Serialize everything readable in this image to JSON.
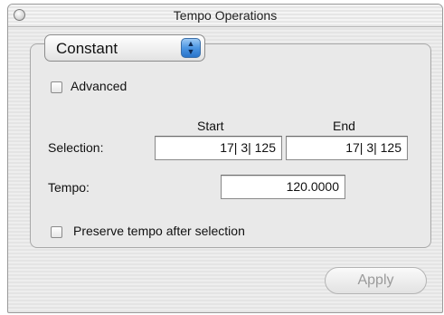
{
  "window": {
    "title": "Tempo Operations"
  },
  "mode_popup": {
    "selected": "Constant",
    "arrows_glyph": "▲\n▼"
  },
  "advanced": {
    "label": "Advanced",
    "checked": false
  },
  "selection": {
    "start_header": "Start",
    "end_header": "End",
    "label": "Selection:",
    "start_value": "17| 3| 125",
    "end_value": "17| 3| 125"
  },
  "tempo": {
    "label": "Tempo:",
    "value": "120.0000"
  },
  "preserve": {
    "label": "Preserve tempo after selection",
    "checked": false
  },
  "apply": {
    "label": "Apply",
    "enabled": false
  },
  "colors": {
    "popup_accent": "#4b95e2",
    "disabled_text": "#9a9a9a"
  }
}
